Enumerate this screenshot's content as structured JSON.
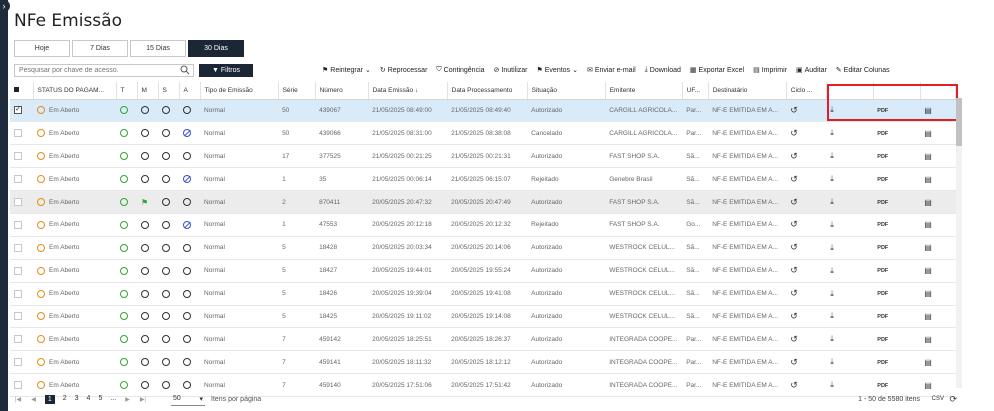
{
  "page": {
    "title": "NFe Emissão"
  },
  "period_tabs": [
    {
      "label": "Hoje",
      "active": false
    },
    {
      "label": "7 Dias",
      "active": false
    },
    {
      "label": "15 Dias",
      "active": false
    },
    {
      "label": "30 Dias",
      "active": true
    }
  ],
  "search": {
    "placeholder": "Pesquisar por chave de acesso."
  },
  "filter_button": {
    "label": "Filtros"
  },
  "toolbar": [
    {
      "icon": "flag-icon",
      "label": "Reintegrar",
      "dropdown": true
    },
    {
      "icon": "refresh-icon",
      "label": "Reprocessar",
      "dropdown": false
    },
    {
      "icon": "contingency-icon",
      "label": "Contingência",
      "dropdown": false
    },
    {
      "icon": "ban-icon",
      "label": "Inutilizar",
      "dropdown": false
    },
    {
      "icon": "flag-icon",
      "label": "Eventos",
      "dropdown": true
    },
    {
      "icon": "email-icon",
      "label": "Enviar e-mail",
      "dropdown": false
    },
    {
      "icon": "download-icon",
      "label": "Download",
      "dropdown": false
    },
    {
      "icon": "excel-icon",
      "label": "Exportar Excel",
      "dropdown": false
    },
    {
      "icon": "pdf-icon",
      "label": "Imprimir",
      "dropdown": false
    },
    {
      "icon": "audit-icon",
      "label": "Auditar",
      "dropdown": false
    },
    {
      "icon": "edit-icon",
      "label": "Editar Colunas",
      "dropdown": false
    }
  ],
  "columns": {
    "status_pagamento": "STATUS DO PAGAM...",
    "t": "T",
    "m": "M",
    "s": "S",
    "a": "A",
    "tipo_emissao": "Tipo de Emissão",
    "serie": "Série",
    "numero": "Número",
    "data_emissao": "Data Emissão",
    "data_processamento": "Data Processamento",
    "situacao": "Situação",
    "emitente": "Emitente",
    "uf": "UF...",
    "destinatario": "Destinatário",
    "ciclo": "Ciclo ..."
  },
  "rows": [
    {
      "status": "Em Aberto",
      "a_ban": false,
      "m_flag": false,
      "tipo": "Normal",
      "serie": "50",
      "numero": "439067",
      "emissao": "21/05/2025 08:49:00",
      "processamento": "21/05/2025 08:49:40",
      "situacao": "Autorizado",
      "emitente": "CARGILL AGRICOLA...",
      "uf": "Par...",
      "destinatario": "NF-E EMITIDA EM A...",
      "pdf": "PDF",
      "selected": true
    },
    {
      "status": "Em Aberto",
      "a_ban": true,
      "m_flag": false,
      "tipo": "Normal",
      "serie": "50",
      "numero": "439066",
      "emissao": "21/05/2025 08:31:00",
      "processamento": "21/05/2025 08:38:08",
      "situacao": "Cancelado",
      "emitente": "CARGILL AGRICOLA...",
      "uf": "Par...",
      "destinatario": "NF-E EMITIDA EM A...",
      "pdf": "PDF",
      "selected": false
    },
    {
      "status": "Em Aberto",
      "a_ban": false,
      "m_flag": false,
      "tipo": "Normal",
      "serie": "17",
      "numero": "377525",
      "emissao": "21/05/2025 00:21:25",
      "processamento": "21/05/2025 00:21:31",
      "situacao": "Autorizado",
      "emitente": "FAST SHOP S.A.",
      "uf": "Sã...",
      "destinatario": "NF-E EMITIDA EM A...",
      "pdf": "PDF",
      "selected": false
    },
    {
      "status": "Em Aberto",
      "a_ban": true,
      "m_flag": false,
      "tipo": "Normal",
      "serie": "1",
      "numero": "35",
      "emissao": "21/05/2025 00:06:14",
      "processamento": "21/05/2025 06:15:07",
      "situacao": "Rejeitado",
      "emitente": "Genebre Brasil",
      "uf": "Sã...",
      "destinatario": "NF-E EMITIDA EM A...",
      "pdf": "PDF",
      "selected": false
    },
    {
      "status": "Em Aberto",
      "a_ban": false,
      "m_flag": true,
      "tipo": "Normal",
      "serie": "2",
      "numero": "870411",
      "emissao": "20/05/2025 20:47:32",
      "processamento": "20/05/2025 20:47:49",
      "situacao": "Autorizado",
      "emitente": "FAST SHOP S.A.",
      "uf": "Sã...",
      "destinatario": "NF-E EMITIDA EM A...",
      "pdf": "PDF",
      "selected": false
    },
    {
      "status": "Em Aberto",
      "a_ban": true,
      "m_flag": false,
      "tipo": "Normal",
      "serie": "1",
      "numero": "47553",
      "emissao": "20/05/2025 20:12:18",
      "processamento": "20/05/2025 20:12:32",
      "situacao": "Rejeitado",
      "emitente": "FAST SHOP S.A.",
      "uf": "Go...",
      "destinatario": "NF-E EMITIDA EM A...",
      "pdf": "PDF",
      "selected": false
    },
    {
      "status": "Em Aberto",
      "a_ban": false,
      "m_flag": false,
      "tipo": "Normal",
      "serie": "5",
      "numero": "18428",
      "emissao": "20/05/2025 20:03:34",
      "processamento": "20/05/2025 20:14:06",
      "situacao": "Autorizado",
      "emitente": "WESTROCK CELUL...",
      "uf": "Sã...",
      "destinatario": "NF-E EMITIDA EM A...",
      "pdf": "PDF",
      "selected": false
    },
    {
      "status": "Em Aberto",
      "a_ban": false,
      "m_flag": false,
      "tipo": "Normal",
      "serie": "5",
      "numero": "18427",
      "emissao": "20/05/2025 19:44:01",
      "processamento": "20/05/2025 19:55:24",
      "situacao": "Autorizado",
      "emitente": "WESTROCK CELUL...",
      "uf": "Sã...",
      "destinatario": "NF-E EMITIDA EM A...",
      "pdf": "PDF",
      "selected": false
    },
    {
      "status": "Em Aberto",
      "a_ban": false,
      "m_flag": false,
      "tipo": "Normal",
      "serie": "5",
      "numero": "18426",
      "emissao": "20/05/2025 19:39:04",
      "processamento": "20/05/2025 19:41:08",
      "situacao": "Autorizado",
      "emitente": "WESTROCK CELUL...",
      "uf": "Sã...",
      "destinatario": "NF-E EMITIDA EM A...",
      "pdf": "PDF",
      "selected": false
    },
    {
      "status": "Em Aberto",
      "a_ban": false,
      "m_flag": false,
      "tipo": "Normal",
      "serie": "5",
      "numero": "18425",
      "emissao": "20/05/2025 19:11:02",
      "processamento": "20/05/2025 19:14:08",
      "situacao": "Autorizado",
      "emitente": "WESTROCK CELUL...",
      "uf": "Sã...",
      "destinatario": "NF-E EMITIDA EM A...",
      "pdf": "PDF",
      "selected": false
    },
    {
      "status": "Em Aberto",
      "a_ban": false,
      "m_flag": false,
      "tipo": "Normal",
      "serie": "7",
      "numero": "459142",
      "emissao": "20/05/2025 18:25:51",
      "processamento": "20/05/2025 18:26:37",
      "situacao": "Autorizado",
      "emitente": "INTEGRADA COOPE...",
      "uf": "Par...",
      "destinatario": "NF-E EMITIDA EM A...",
      "pdf": "PDF",
      "selected": false
    },
    {
      "status": "Em Aberto",
      "a_ban": false,
      "m_flag": false,
      "tipo": "Normal",
      "serie": "7",
      "numero": "459141",
      "emissao": "20/05/2025 18:11:32",
      "processamento": "20/05/2025 18:12:12",
      "situacao": "Autorizado",
      "emitente": "INTEGRADA COOPE...",
      "uf": "Par...",
      "destinatario": "NF-E EMITIDA EM A...",
      "pdf": "PDF",
      "selected": false
    },
    {
      "status": "Em Aberto",
      "a_ban": false,
      "m_flag": false,
      "tipo": "Normal",
      "serie": "7",
      "numero": "459140",
      "emissao": "20/05/2025 17:51:06",
      "processamento": "20/05/2025 17:51:42",
      "situacao": "Autorizado",
      "emitente": "INTEGRADA COOPE...",
      "uf": "Par...",
      "destinatario": "NF-E EMITIDA EM A...",
      "pdf": "PDF",
      "selected": false
    }
  ],
  "pagination": {
    "pages": [
      "1",
      "2",
      "3",
      "4",
      "5",
      "..."
    ],
    "active_page": "1",
    "page_size": "50",
    "page_size_label": "Itens por página",
    "info": "1 - 50 de 5580 itens",
    "csv_label": "CSV"
  },
  "colors": {
    "accent": "#1b2735",
    "selected_row": "#d9ebf9",
    "highlight": "#e21f26"
  }
}
